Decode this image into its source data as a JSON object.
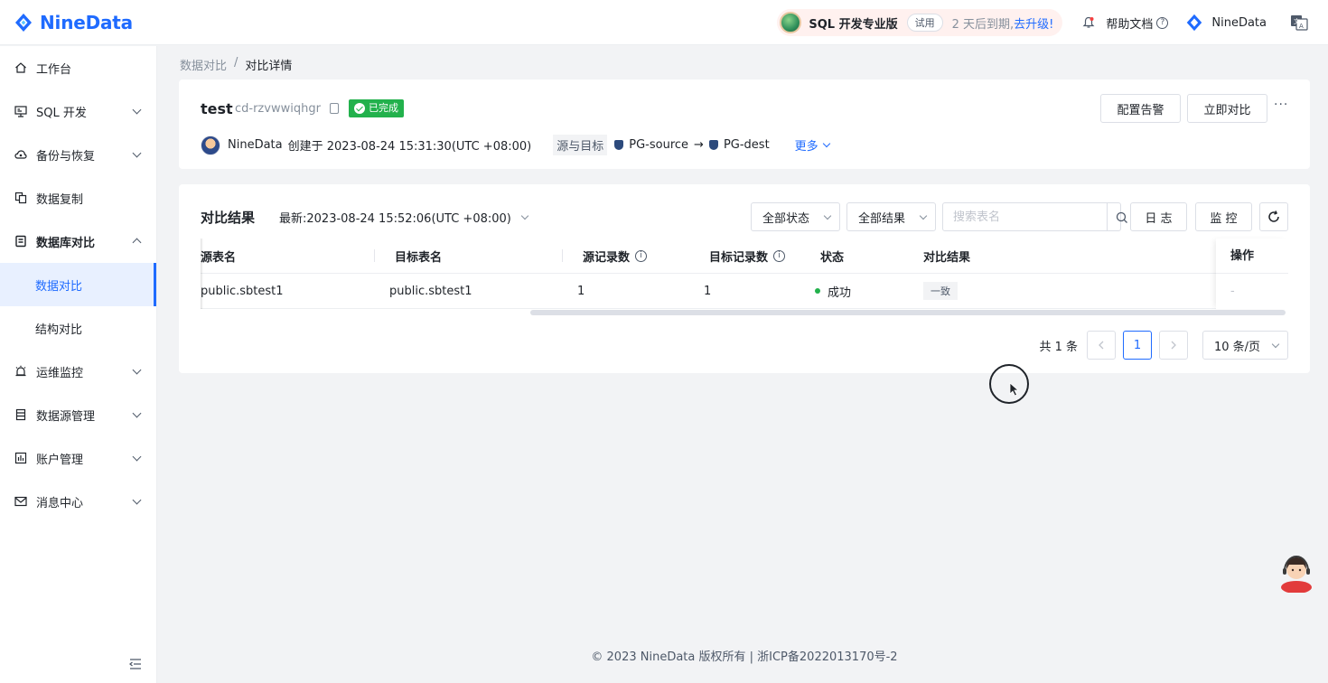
{
  "brand": {
    "name": "NineData"
  },
  "topbar": {
    "plan_name": "SQL 开发专业版",
    "trial_tag": "试用",
    "expire_text": "2 天后到期,",
    "upgrade_link": "去升级!",
    "help_label": "帮助文档",
    "user_name": "NineData"
  },
  "sidebar": {
    "items": [
      {
        "label": "工作台",
        "icon": "home-icon"
      },
      {
        "label": "SQL 开发",
        "icon": "monitor-icon"
      },
      {
        "label": "备份与恢复",
        "icon": "cloud-icon"
      },
      {
        "label": "数据复制",
        "icon": "copy-icon"
      },
      {
        "label": "数据库对比",
        "icon": "compare-icon"
      },
      {
        "label": "运维监控",
        "icon": "alarm-icon"
      },
      {
        "label": "数据源管理",
        "icon": "database-icon"
      },
      {
        "label": "账户管理",
        "icon": "account-icon"
      },
      {
        "label": "消息中心",
        "icon": "mail-icon"
      }
    ],
    "sub_items": [
      {
        "label": "数据对比",
        "active": true
      },
      {
        "label": "结构对比",
        "active": false
      }
    ]
  },
  "breadcrumb": {
    "parent": "数据对比",
    "separator": "/",
    "current": "对比详情"
  },
  "task": {
    "name": "test",
    "id": "cd-rzvwwiqhgr",
    "status": "已完成",
    "creator": "NineData",
    "created_text": "创建于 2023-08-24 15:31:30(UTC +08:00)",
    "src_target_label": "源与目标",
    "source": "PG-source",
    "arrow": "→",
    "target": "PG-dest",
    "more": "更多",
    "btn_alert": "配置告警",
    "btn_compare": "立即对比",
    "dots": "···"
  },
  "result": {
    "title": "对比结果",
    "latest": "最新:2023-08-24 15:52:06(UTC +08:00)",
    "filter_status": "全部状态",
    "filter_result": "全部结果",
    "search_placeholder": "搜索表名",
    "btn_log": "日 志",
    "btn_monitor": "监 控",
    "columns": [
      "源表名",
      "目标表名",
      "源记录数",
      "目标记录数",
      "状态",
      "对比结果",
      "操作"
    ],
    "rows": [
      {
        "src": "public.sbtest1",
        "dst": "public.sbtest1",
        "src_count": "1",
        "dst_count": "1",
        "status": "成功",
        "result": "一致",
        "op": "-"
      }
    ],
    "total": "共 1 条",
    "page": "1",
    "page_size": "10 条/页"
  },
  "footer": {
    "text": "© 2023 NineData 版权所有 | 浙ICP备2022013170号-2"
  },
  "colors": {
    "primary": "#1f6bff",
    "success": "#22b14c",
    "bg": "#f2f3f5"
  }
}
